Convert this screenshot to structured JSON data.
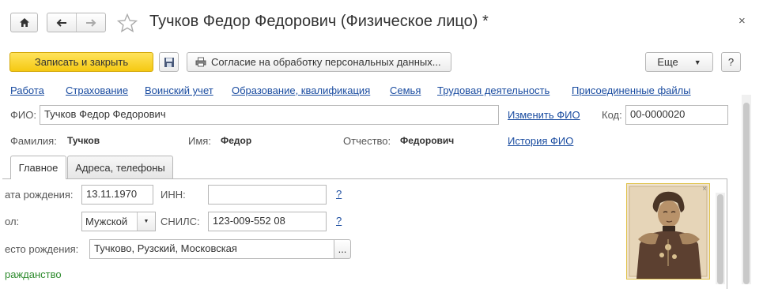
{
  "window": {
    "title": "Тучков Федор Федорович (Физическое лицо) *",
    "close_icon": "×"
  },
  "toolbar": {
    "save_close_label": "Записать и закрыть",
    "consent_label": "Согласие на обработку персональных данных...",
    "more_label": "Еще",
    "help_label": "?"
  },
  "links": [
    "Работа",
    "Страхование",
    "Воинский учет",
    "Образование, квалификация",
    "Семья",
    "Трудовая деятельность",
    "Присоединенные файлы"
  ],
  "fio": {
    "label": "ФИО:",
    "value": "Тучков Федор Федорович",
    "change_link": "Изменить ФИО",
    "code_label": "Код:",
    "code_value": "00-0000020",
    "surname_label": "Фамилия:",
    "surname_value": "Тучков",
    "name_label": "Имя:",
    "name_value": "Федор",
    "patronymic_label": "Отчество:",
    "patronymic_value": "Федорович",
    "history_link": "История ФИО"
  },
  "tabs": [
    {
      "label": "Главное",
      "active": true
    },
    {
      "label": "Адреса, телефоны",
      "active": false
    }
  ],
  "main": {
    "birthdate_label": "ата рождения:",
    "birthdate_value": "13.11.1970",
    "inn_label": "ИНН:",
    "inn_value": "",
    "gender_label": "ол:",
    "gender_value": "Мужской",
    "snils_label": "СНИЛС:",
    "snils_value": "123-009-552 08",
    "birthplace_label": "есто рождения:",
    "birthplace_value": "Тучково, Рузский, Московская",
    "ellipsis": "...",
    "citizenship_label": "ражданство",
    "help_q": "?"
  },
  "colors": {
    "accent_yellow": "#f5c912",
    "link_blue": "#1a4ca0",
    "green_text": "#2e8b2e"
  }
}
